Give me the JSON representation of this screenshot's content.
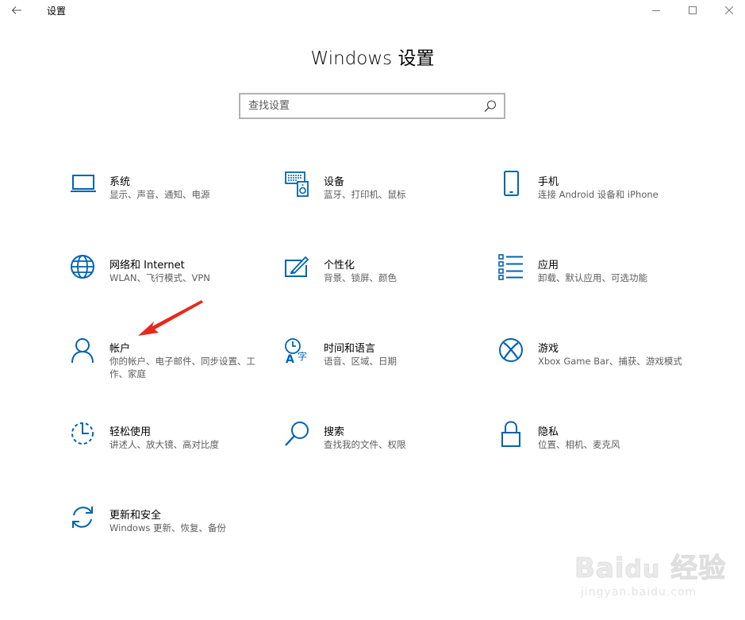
{
  "window": {
    "title": "设置"
  },
  "page": {
    "title": "Windows 设置"
  },
  "search": {
    "placeholder": "查找设置"
  },
  "colors": {
    "accent": "#0063b1",
    "arrow": "#e8281c"
  },
  "tiles": [
    {
      "title": "系统",
      "desc": "显示、声音、通知、电源",
      "icon": "laptop-icon"
    },
    {
      "title": "设备",
      "desc": "蓝牙、打印机、鼠标",
      "icon": "devices-icon"
    },
    {
      "title": "手机",
      "desc": "连接 Android 设备和 iPhone",
      "icon": "phone-icon"
    },
    {
      "title": "网络和 Internet",
      "desc": "WLAN、飞行模式、VPN",
      "icon": "globe-icon"
    },
    {
      "title": "个性化",
      "desc": "背景、锁屏、颜色",
      "icon": "personalization-icon"
    },
    {
      "title": "应用",
      "desc": "卸载、默认应用、可选功能",
      "icon": "apps-list-icon"
    },
    {
      "title": "帐户",
      "desc": "你的帐户、电子邮件、同步设置、工作、家庭",
      "icon": "person-icon"
    },
    {
      "title": "时间和语言",
      "desc": "语音、区域、日期",
      "icon": "time-language-icon"
    },
    {
      "title": "游戏",
      "desc": "Xbox Game Bar、捕获、游戏模式",
      "icon": "xbox-icon"
    },
    {
      "title": "轻松使用",
      "desc": "讲述人、放大镜、高对比度",
      "icon": "ease-of-access-icon"
    },
    {
      "title": "搜索",
      "desc": "查找我的文件、权限",
      "icon": "search-icon"
    },
    {
      "title": "隐私",
      "desc": "位置、相机、麦克风",
      "icon": "lock-icon"
    },
    {
      "title": "更新和安全",
      "desc": "Windows 更新、恢复、备份",
      "icon": "sync-icon"
    }
  ],
  "watermark": {
    "url": "jingyan.baidu.com"
  }
}
